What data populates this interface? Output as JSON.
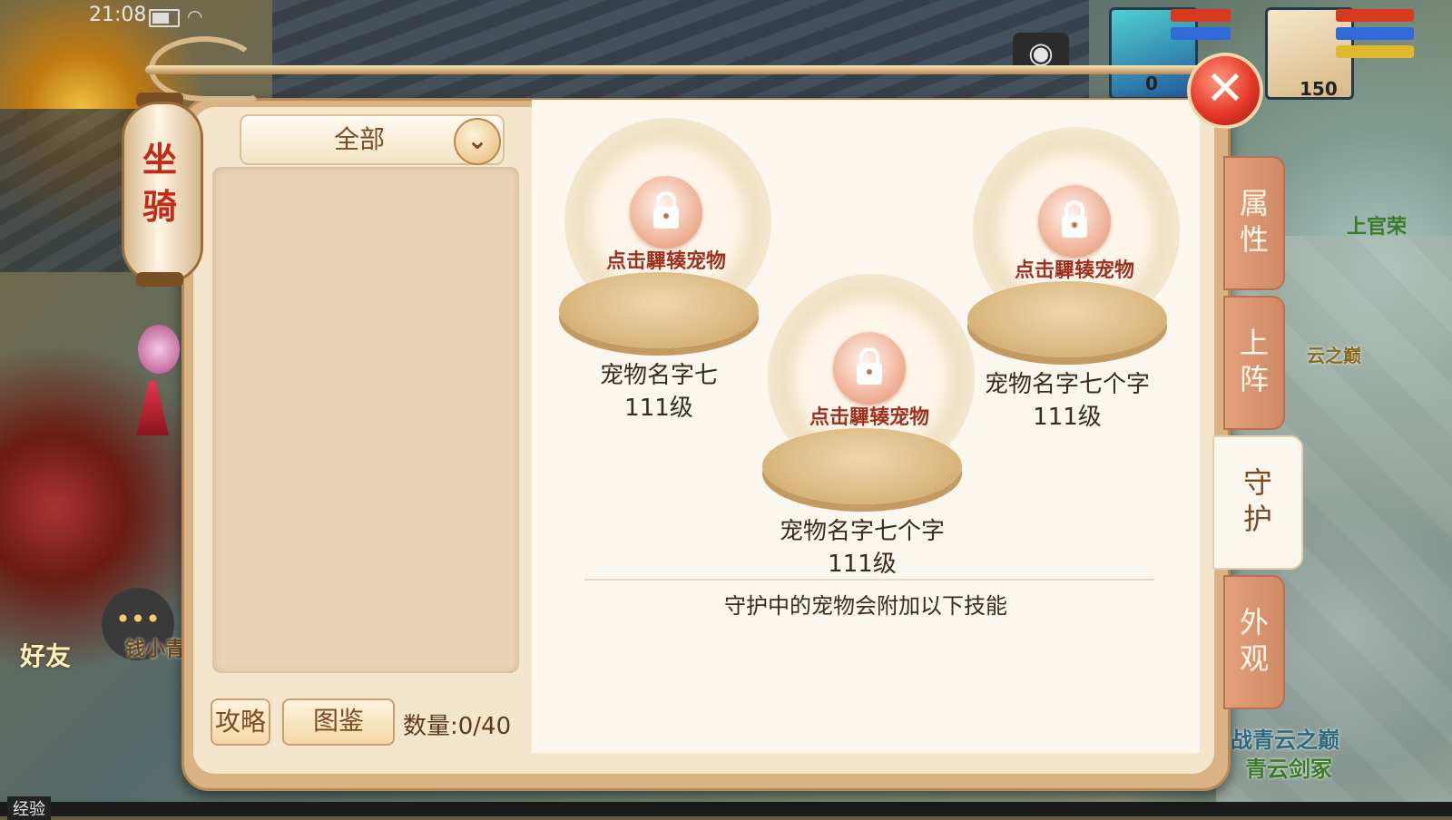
{
  "status": {
    "time": "21:08"
  },
  "hud": {
    "level_1": "0",
    "level_2": "150"
  },
  "background": {
    "npc_name": "上官荣",
    "sign_1": "云之巅",
    "event_1": "战青云之巅",
    "event_2": "青云剑冢",
    "friend_label": "好友",
    "chat_name": "钱小青",
    "exp_label": "经验"
  },
  "lantern": {
    "title_line1": "坐",
    "title_line2": "骑"
  },
  "filter": {
    "selected": "全部"
  },
  "footer": {
    "guide_label": "攻略",
    "codex_label": "图鉴",
    "count_label": "数量:0/40"
  },
  "slots": [
    {
      "hint": "点击驆辏宠物",
      "name": "宠物名字七",
      "level": "111级"
    },
    {
      "hint": "点击驆辏宠物",
      "name": "宠物名字七个字",
      "level": "111级"
    },
    {
      "hint": "点击驆辏宠物",
      "name": "宠物名字七个字",
      "level": "111级"
    }
  ],
  "skill_note": "守护中的宠物会附加以下技能",
  "tabs": [
    {
      "label_line1": "属",
      "label_line2": "性"
    },
    {
      "label_line1": "上",
      "label_line2": "阵"
    },
    {
      "label_line1": "守",
      "label_line2": "护"
    },
    {
      "label_line1": "外",
      "label_line2": "观"
    }
  ],
  "active_tab": "守护",
  "colors": {
    "accent": "#c42a18",
    "close": "#e5382a",
    "tab": "#d08a66",
    "panel": "#f4e6cc"
  }
}
